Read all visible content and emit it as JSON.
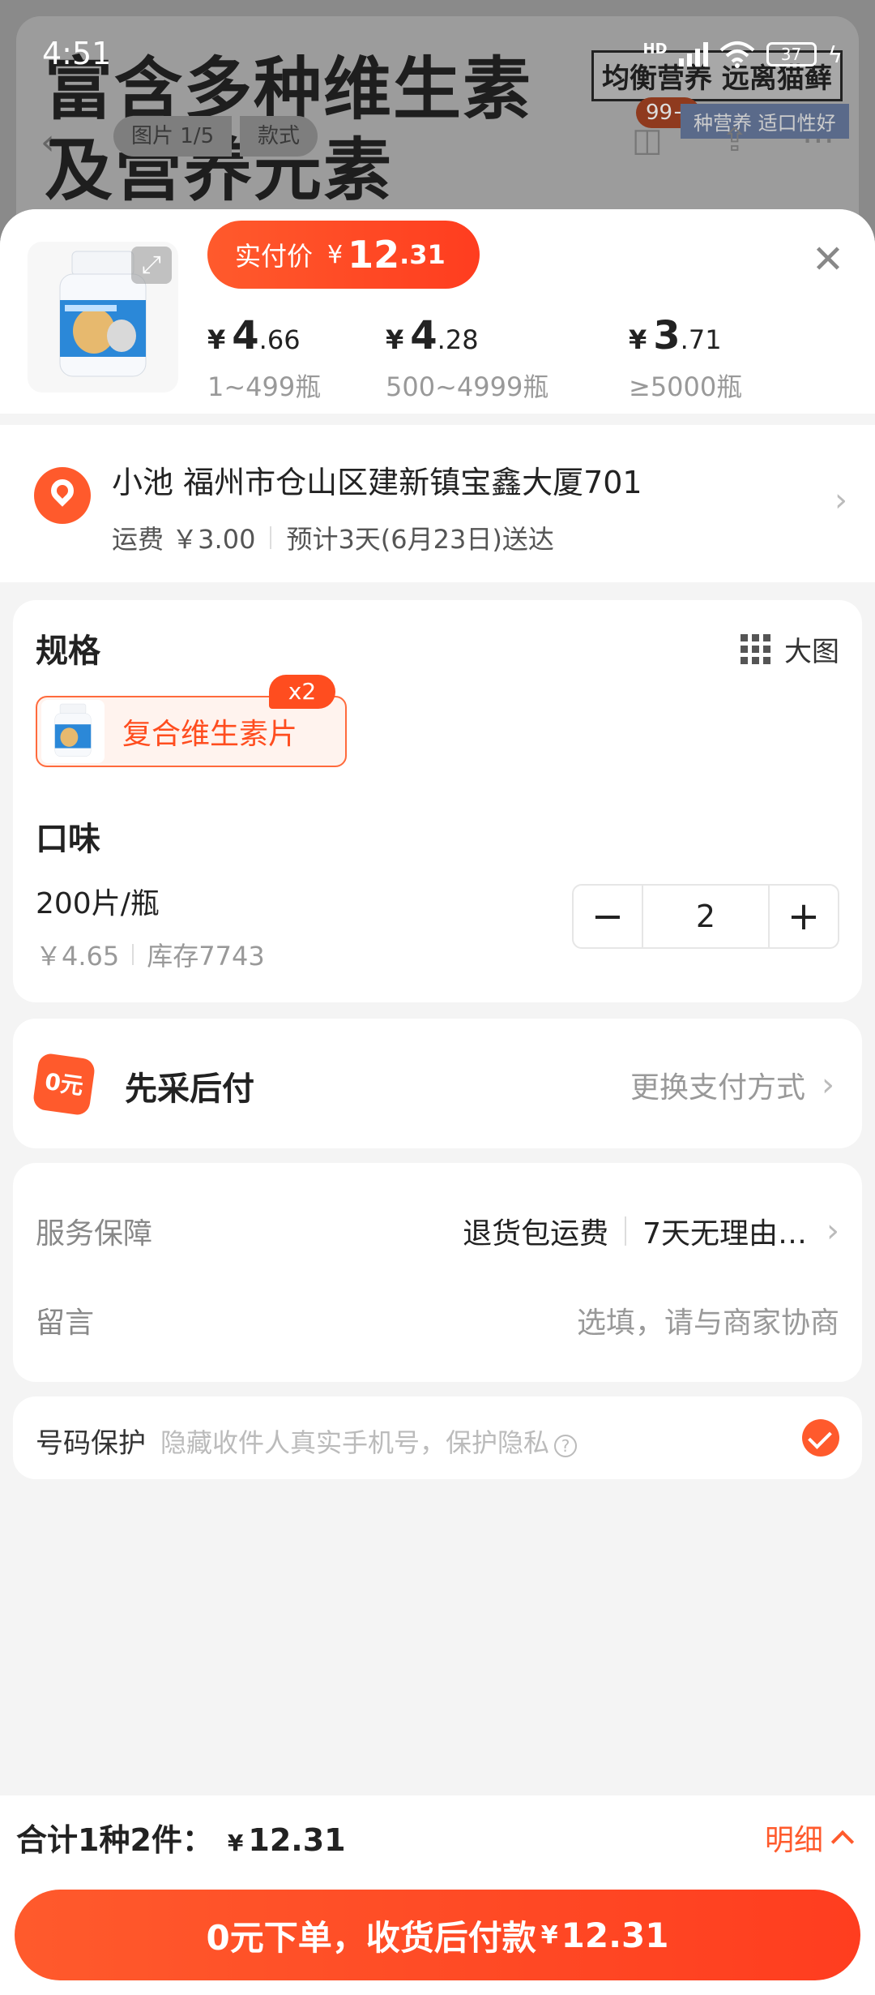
{
  "background": {
    "headline_line1": "富含多种维生素",
    "headline_line2": "及营养元素",
    "tag": "均衡营养 远离猫藓",
    "badge": "99+",
    "subtag": "种营养 适口性好",
    "image_counter": "图片 1/5",
    "style_tab": "款式"
  },
  "status_bar": {
    "time": "4:51",
    "network": "HD",
    "battery": "37"
  },
  "sheet": {
    "price_pill": {
      "label": "实付价",
      "currency": "¥",
      "integer": "12",
      "decimal": ".31"
    },
    "tiers": [
      {
        "currency": "¥",
        "integer": "4",
        "decimal": ".66",
        "range": "1~499瓶"
      },
      {
        "currency": "¥",
        "integer": "4",
        "decimal": ".28",
        "range": "500~4999瓶"
      },
      {
        "currency": "¥",
        "integer": "3",
        "decimal": ".71",
        "range": "≥5000瓶"
      }
    ]
  },
  "address": {
    "line": "小池 福州市仓山区建新镇宝鑫大厦701",
    "shipping": "运费 ￥3.00",
    "delivery": "预计3天(6月23日)送达"
  },
  "spec": {
    "title": "规格",
    "big_image": "大图",
    "option": "复合维生素片",
    "option_count": "x2",
    "taste_title": "口味",
    "taste_value": "200片/瓶",
    "unit_price": "￥4.65",
    "stock": "库存7743",
    "quantity": "2"
  },
  "payment": {
    "icon_text": "0元",
    "title": "先采后付",
    "change": "更换支付方式"
  },
  "service": {
    "label": "服务保障",
    "value1": "退货包运费",
    "value2": "7天无理由…",
    "message_label": "留言",
    "message_placeholder": "选填，请与商家协商"
  },
  "privacy": {
    "label": "号码保护",
    "desc": "隐藏收件人真实手机号，保护隐私"
  },
  "footer": {
    "total_label": "合计1种2件：",
    "total_currency": "¥",
    "total_amount": "12.31",
    "detail": "明细",
    "cta_text": "0元下单，收货后付款",
    "cta_currency": "¥",
    "cta_amount": "12.31"
  },
  "colors": {
    "accent": "#ff5a2c",
    "accent_dark": "#ff3d1f"
  }
}
